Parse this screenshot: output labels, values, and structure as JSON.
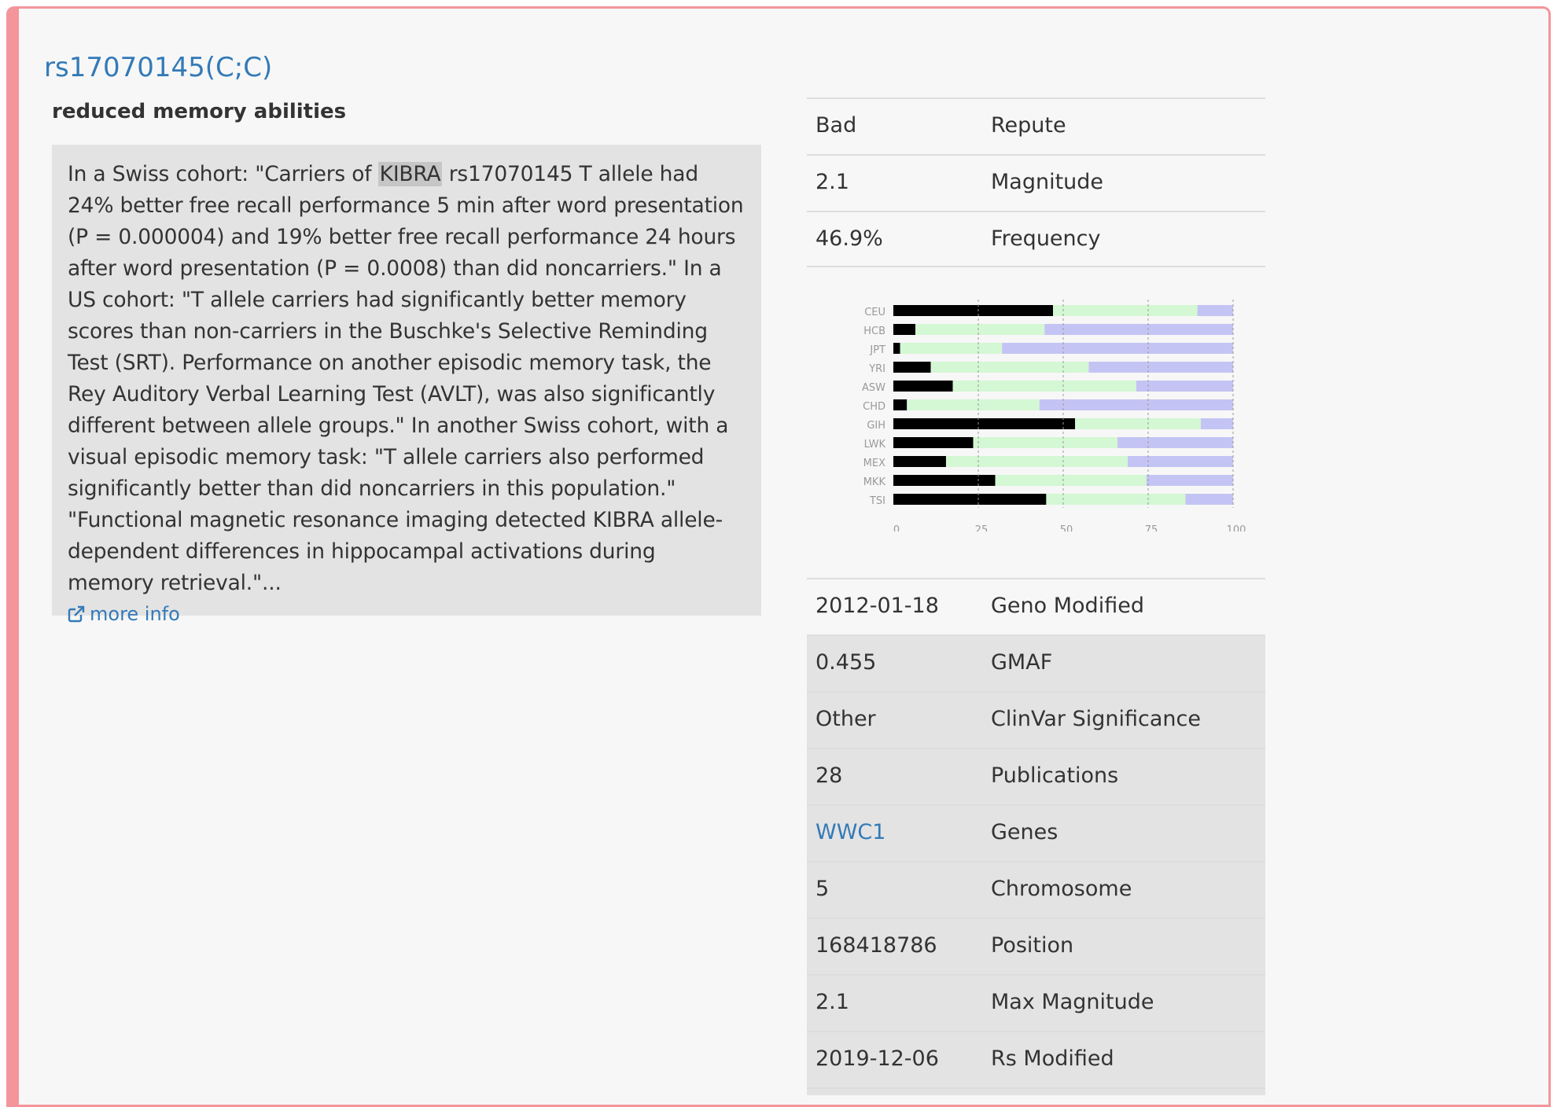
{
  "snp": {
    "title": "rs17070145(C;C)",
    "summary": "reduced memory abilities",
    "description_before": "In a Swiss cohort: \"Carriers of ",
    "description_highlight": "KIBRA",
    "description_after": " rs17070145 T allele had 24% better free recall performance 5 min after word presentation (P = 0.000004) and 19% better free recall performance 24 hours after word presentation (P = 0.0008) than did noncarriers.\" In a US cohort: \"T allele carriers had significantly better memory scores than non-carriers in the Buschke's Selective Reminding Test (SRT). Performance on another episodic memory task, the Rey Auditory Verbal Learning Test (AVLT), was also significantly different between allele groups.\" In another Swiss cohort, with a visual episodic memory task: \"T allele carriers also performed significantly better than did noncarriers in this population.\" \"Functional magnetic resonance imaging detected KIBRA allele-dependent differences in hippocampal activations during memory retrieval.\"...",
    "more_info_label": "more info",
    "more_info_icon": "external-link-icon"
  },
  "top_table": [
    {
      "value": "Bad",
      "key": "Repute"
    },
    {
      "value": "2.1",
      "key": "Magnitude"
    },
    {
      "value": "46.9%",
      "key": "Frequency"
    }
  ],
  "bottom_table": [
    {
      "value": "2012-01-18",
      "key": "Geno Modified",
      "link": false
    },
    {
      "value": "0.455",
      "key": "GMAF",
      "link": false
    },
    {
      "value": "Other",
      "key": "ClinVar Significance",
      "link": false
    },
    {
      "value": "28",
      "key": "Publications",
      "link": false
    },
    {
      "value": "WWC1",
      "key": "Genes",
      "link": true
    },
    {
      "value": "5",
      "key": "Chromosome",
      "link": false
    },
    {
      "value": "168418786",
      "key": "Position",
      "link": false
    },
    {
      "value": "2.1",
      "key": "Max Magnitude",
      "link": false
    },
    {
      "value": "2019-12-06",
      "key": "Rs Modified",
      "link": false
    }
  ],
  "colors": {
    "link": "#337ab7",
    "border": "#f3959a",
    "series1": "#000000",
    "series2": "#d4f7d4",
    "series3": "#c4c4f4"
  },
  "chart_data": {
    "type": "bar",
    "orientation": "horizontal",
    "stacked": true,
    "categories": [
      "CEU",
      "HCB",
      "JPT",
      "YRI",
      "ASW",
      "CHD",
      "GIH",
      "LWK",
      "MEX",
      "MKK",
      "TSI"
    ],
    "series": [
      {
        "values": [
          47,
          6.5,
          2,
          11,
          17.5,
          4,
          53.5,
          23.5,
          15.5,
          30,
          45
        ]
      },
      {
        "values": [
          42.5,
          38,
          30,
          46.5,
          54,
          39,
          37,
          42.5,
          53.5,
          44.5,
          41
        ]
      },
      {
        "values": [
          10.5,
          55.5,
          68,
          42.5,
          28.5,
          57,
          9.5,
          34,
          31,
          25.5,
          14
        ]
      }
    ],
    "xticks": [
      0,
      25,
      50,
      75,
      100
    ],
    "xlim": [
      0,
      100
    ],
    "grid": "vertical-dashed"
  }
}
